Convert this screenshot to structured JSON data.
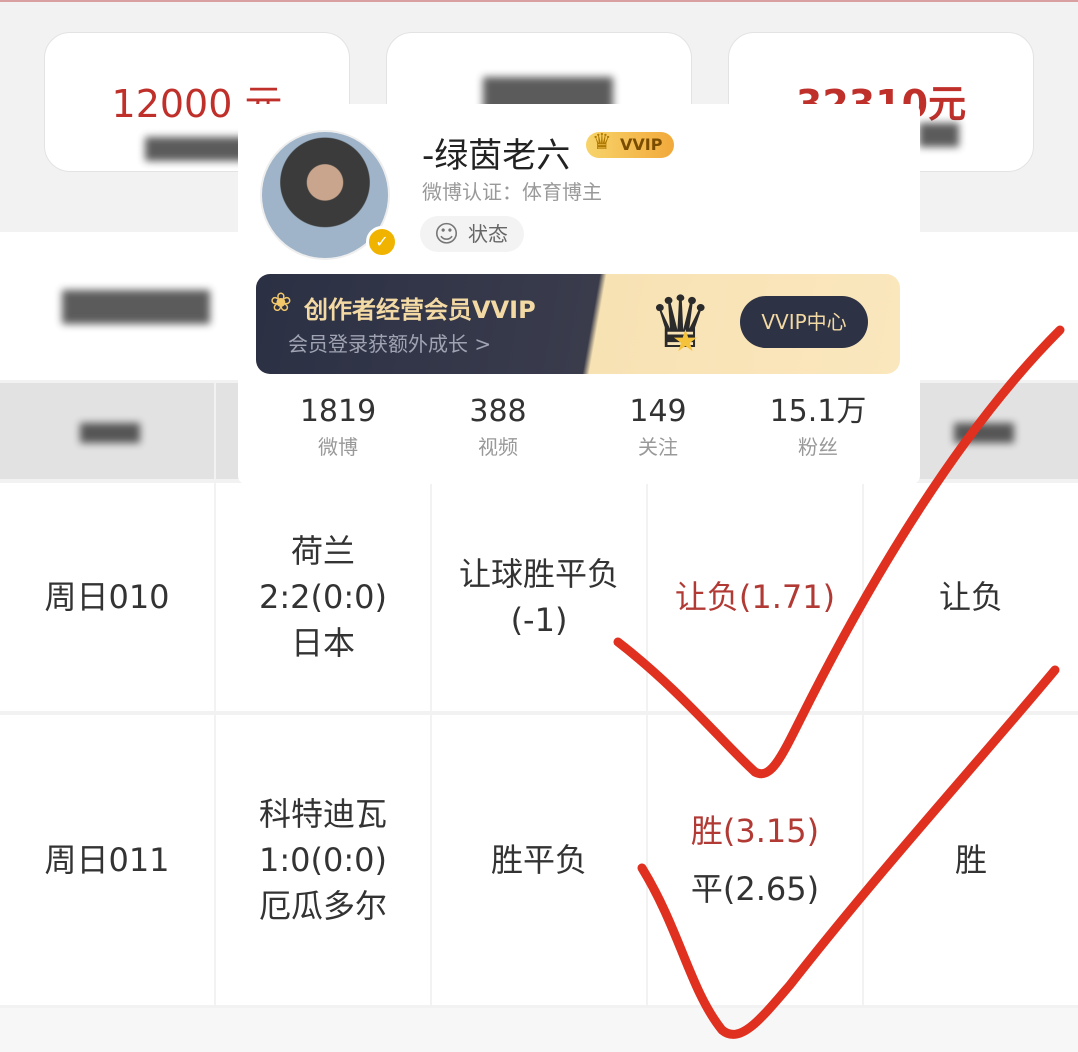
{
  "stat_cards": [
    {
      "value": "12000 元"
    },
    {
      "value": ""
    },
    {
      "value": "32310元"
    }
  ],
  "profile": {
    "name": "-绿茵老六",
    "badge": "VVIP",
    "certification": "微博认证：体育博主",
    "status_label": "状态",
    "banner_title": "创作者经营会员VVIP",
    "banner_subtitle": "会员登录获额外成长 >",
    "banner_button": "VVIP中心",
    "stats": [
      {
        "value": "1819",
        "label": "微博"
      },
      {
        "value": "388",
        "label": "视频"
      },
      {
        "value": "149",
        "label": "关注"
      },
      {
        "value": "15.1万",
        "label": "粉丝"
      }
    ]
  },
  "table": {
    "rows": [
      {
        "match_no": "周日010",
        "home": "荷兰",
        "score": "2:2(0:0)",
        "away": "日本",
        "play_type_1": "让球胜平负",
        "play_type_2": "(-1)",
        "pick_1": "让负(1.71)",
        "pick_2": "",
        "result": "让负"
      },
      {
        "match_no": "周日011",
        "home": "科特迪瓦",
        "score": "1:0(0:0)",
        "away": "厄瓜多尔",
        "play_type_1": "胜平负",
        "play_type_2": "",
        "pick_1": "胜(3.15)",
        "pick_2": "平(2.65)",
        "result": "胜"
      }
    ]
  },
  "colors": {
    "accent_red": "#c0302b",
    "pick_red": "#b23a35",
    "check_mark": "#e0301f"
  }
}
